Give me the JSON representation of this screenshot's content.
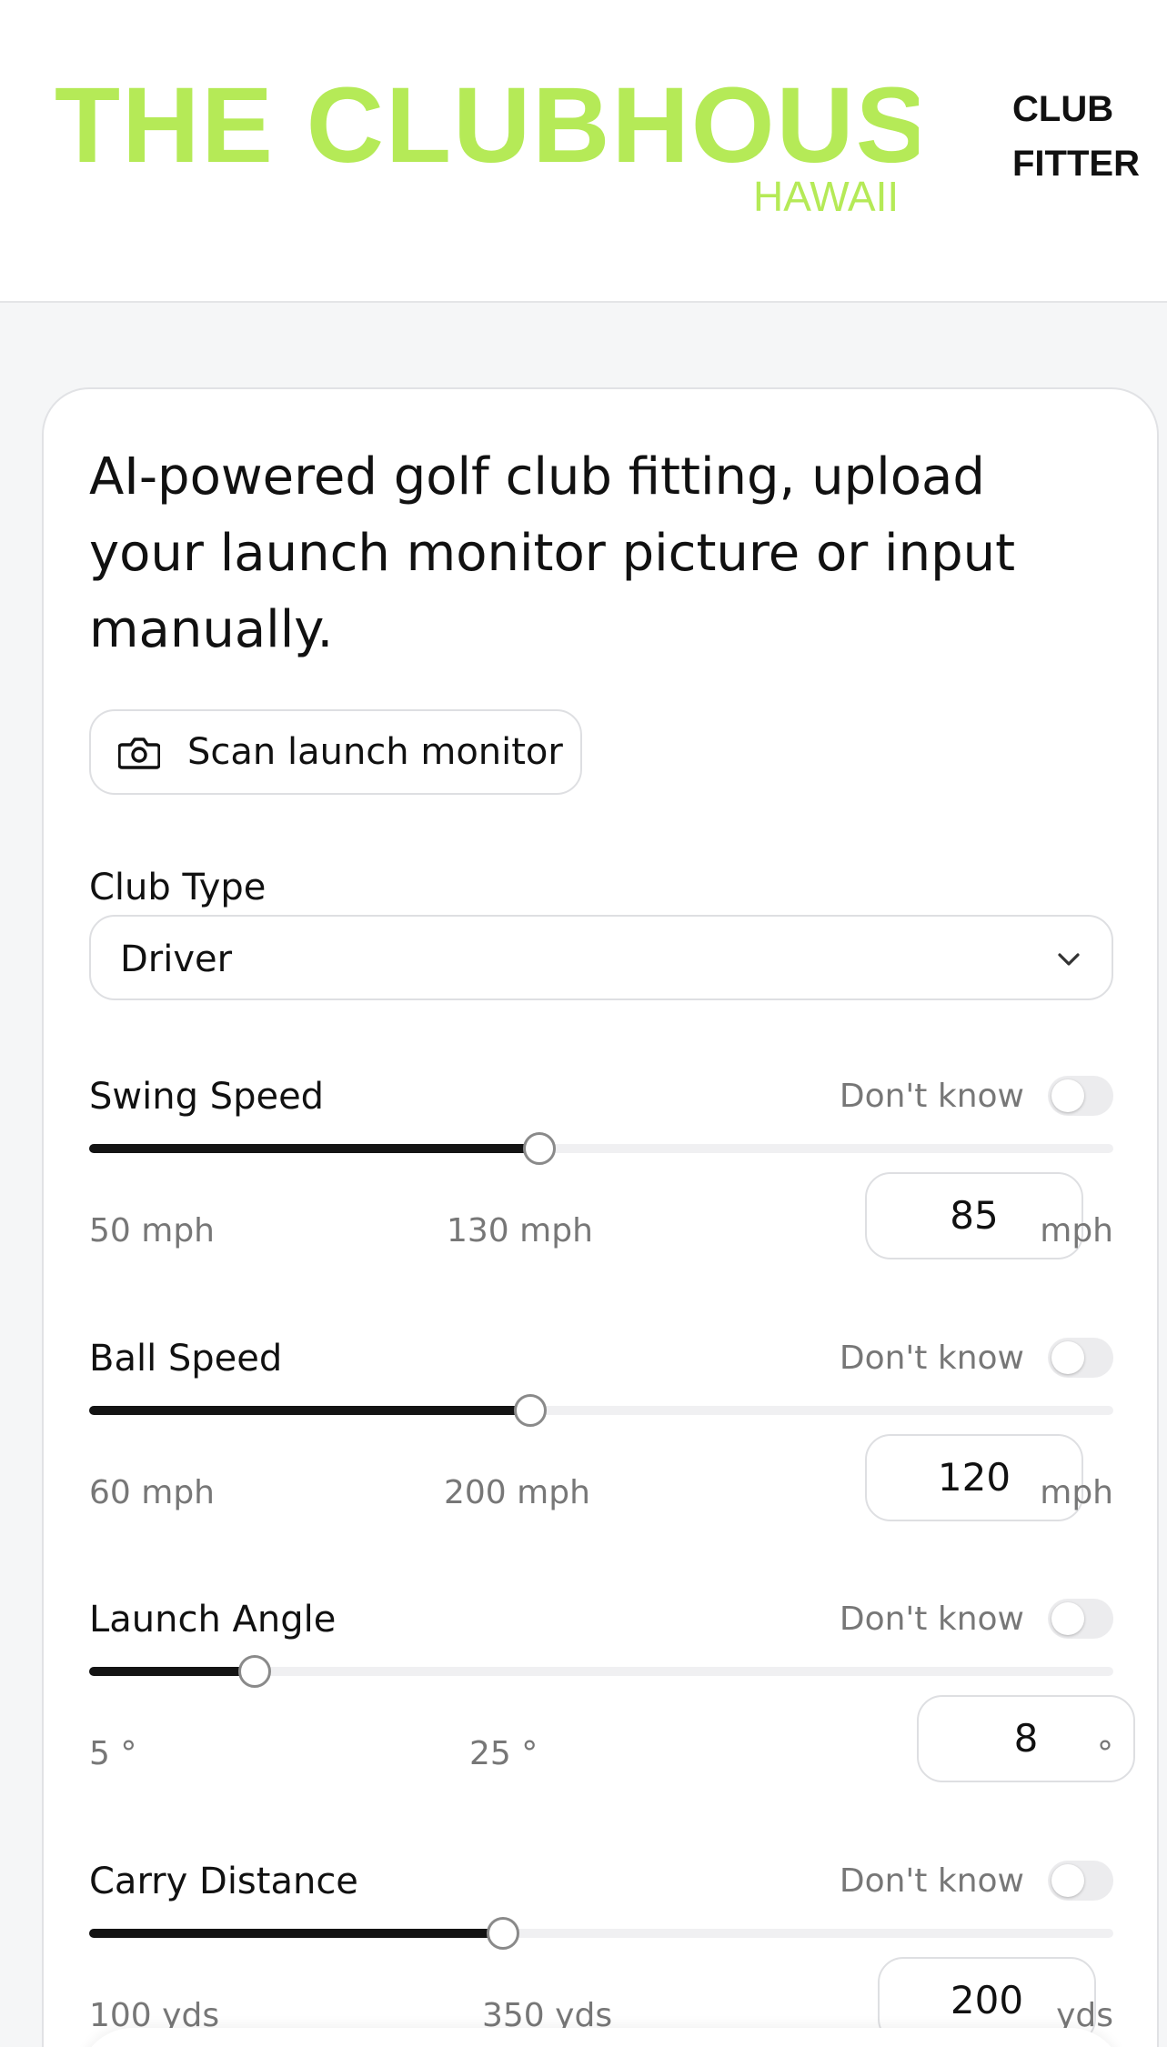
{
  "header": {
    "logo_text": "THE CLUBHOUSE",
    "logo_subtext": "HAWAII",
    "nav_line1": "CLUB",
    "nav_line2": "FITTER"
  },
  "colors": {
    "brand_green": "#b5ea57",
    "slider_fill": "#141414"
  },
  "card": {
    "headline": "AI-powered golf club fitting, upload your launch monitor picture or input manually.",
    "scan_button": {
      "label": "Scan launch monitor",
      "icon": "camera-icon"
    },
    "club_type": {
      "label": "Club Type",
      "value": "Driver",
      "icon": "chevron-down-icon"
    },
    "metrics": [
      {
        "name": "Swing Speed",
        "dont_know": "Don't know",
        "min_label": "50 mph",
        "max_label": "130 mph",
        "min": 50,
        "max": 130,
        "value": "85",
        "unit": "mph"
      },
      {
        "name": "Ball Speed",
        "dont_know": "Don't know",
        "min_label": "60 mph",
        "max_label": "200 mph",
        "min": 60,
        "max": 200,
        "value": "120",
        "unit": "mph"
      },
      {
        "name": "Launch Angle",
        "dont_know": "Don't know",
        "min_label": "5 °",
        "max_label": "25 °",
        "min": 5,
        "max": 25,
        "value": "8",
        "unit": "°"
      },
      {
        "name": "Carry Distance",
        "dont_know": "Don't know",
        "min_label": "100 yds",
        "max_label": "350 yds",
        "min": 100,
        "max": 350,
        "value": "200",
        "unit": "yds"
      }
    ]
  }
}
